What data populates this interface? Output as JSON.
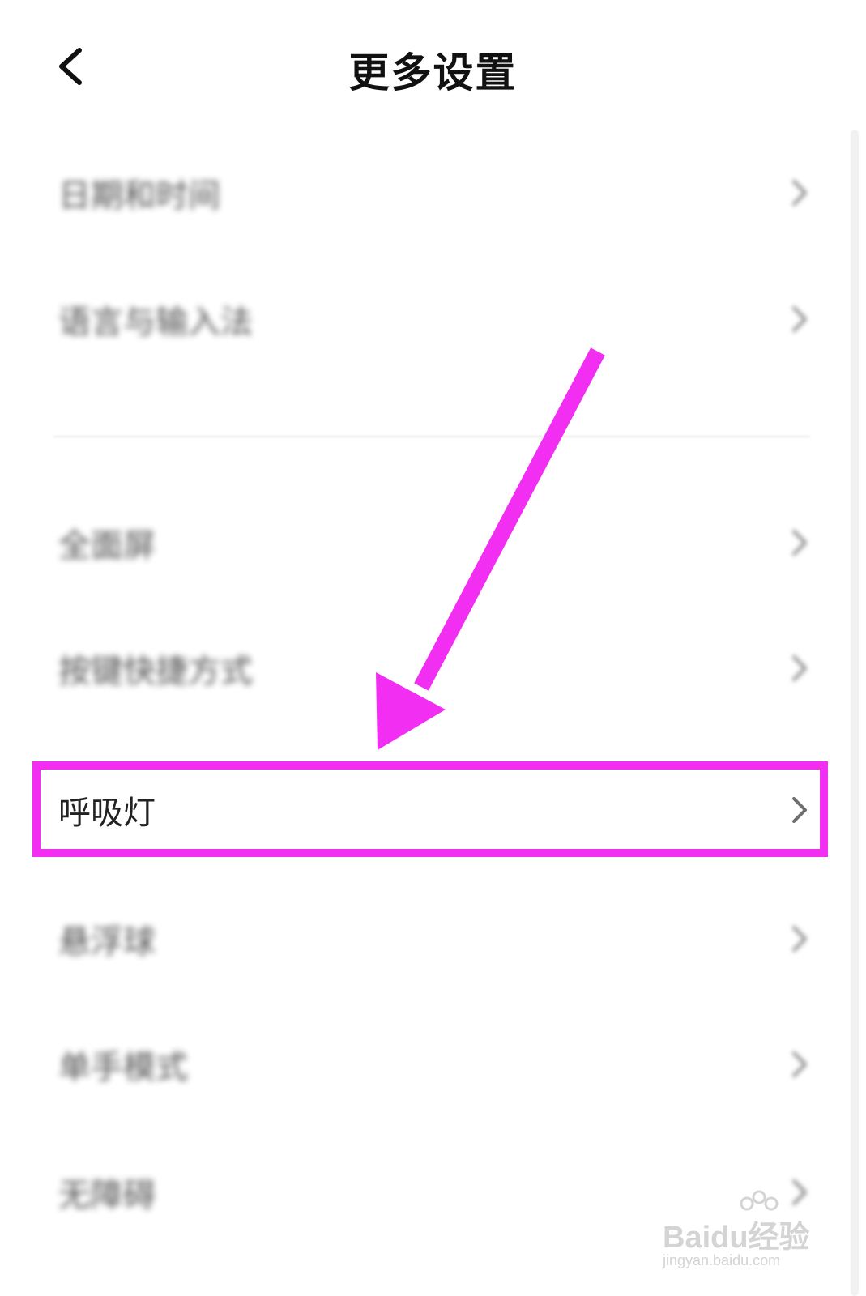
{
  "header": {
    "title": "更多设置",
    "back_icon": "chevron-left-icon"
  },
  "settings": {
    "items": [
      {
        "label": "日期和时间",
        "icon": "chevron-right-icon"
      },
      {
        "label": "语言与输入法",
        "icon": "chevron-right-icon"
      },
      {
        "label": "全面屏",
        "icon": "chevron-right-icon"
      },
      {
        "label": "按键快捷方式",
        "icon": "chevron-right-icon"
      },
      {
        "label": "呼吸灯",
        "icon": "chevron-right-icon"
      },
      {
        "label": "悬浮球",
        "icon": "chevron-right-icon"
      },
      {
        "label": "单手模式",
        "icon": "chevron-right-icon"
      },
      {
        "label": "无障碍",
        "icon": "chevron-right-icon"
      }
    ]
  },
  "annotation": {
    "highlight_color": "#f22ef2",
    "highlighted_item": "呼吸灯"
  },
  "watermark": {
    "brand": "Baidu经验",
    "url": "jingyan.baidu.com"
  }
}
